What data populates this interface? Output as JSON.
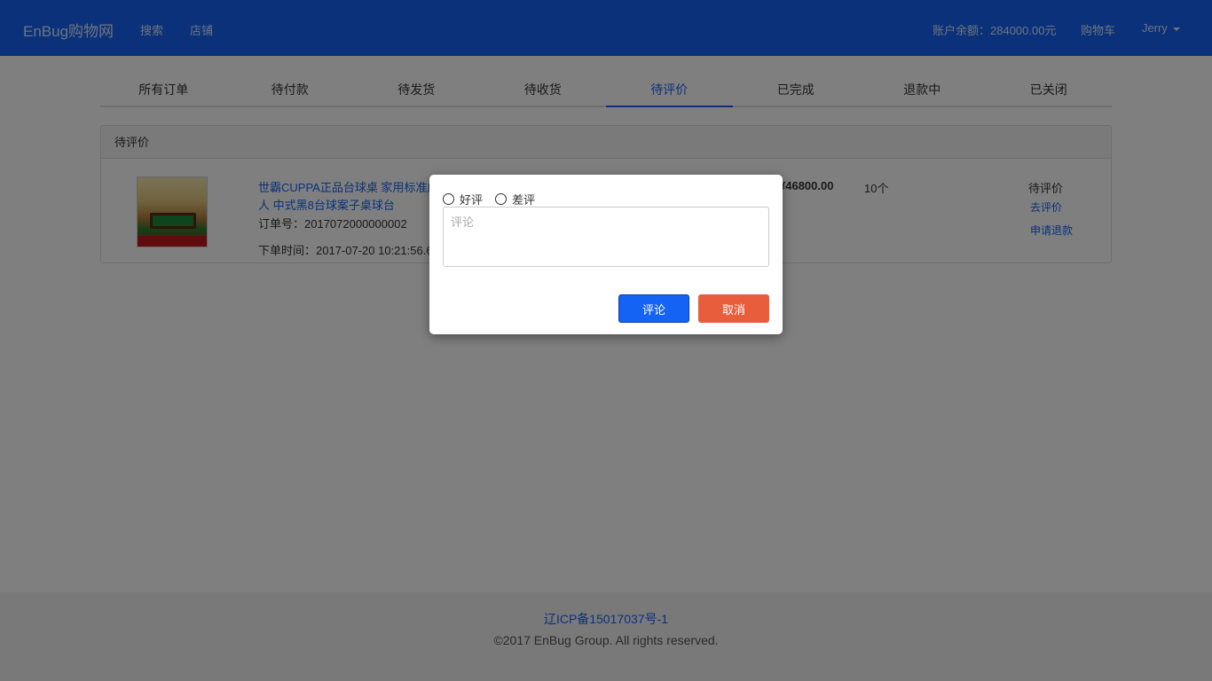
{
  "navbar": {
    "brand": "EnBug购物网",
    "search": "搜索",
    "shop": "店铺",
    "balance": "账户余额：284000.00元",
    "cart": "购物车",
    "user": "Jerry"
  },
  "tabs": [
    {
      "label": "所有订单",
      "active": false
    },
    {
      "label": "待付款",
      "active": false
    },
    {
      "label": "待发货",
      "active": false
    },
    {
      "label": "待收货",
      "active": false
    },
    {
      "label": "待评价",
      "active": true
    },
    {
      "label": "已完成",
      "active": false
    },
    {
      "label": "退款中",
      "active": false
    },
    {
      "label": "已关闭",
      "active": false
    }
  ],
  "panel": {
    "heading": "待评价",
    "order": {
      "product_title": "世霸CUPPA正品台球桌 家用标准成人 中式黑8台球案子桌球台",
      "order_no": "订单号：2017072000000002",
      "order_time": "下单时间：2017-07-20 10:21:56.6",
      "price": "¥46800.00",
      "qty": "10个",
      "status": "待评价",
      "action_review": "去评价",
      "action_refund": "申请退款"
    }
  },
  "modal": {
    "good_label": "好评",
    "bad_label": "差评",
    "comment_placeholder": "评论",
    "submit_label": "评论",
    "cancel_label": "取消"
  },
  "footer": {
    "icp": "辽ICP备15017037号-1",
    "copyright": "©2017 EnBug Group. All rights reserved."
  },
  "colors": {
    "brand": "#1463f5",
    "cancel": "#e85d3c"
  }
}
